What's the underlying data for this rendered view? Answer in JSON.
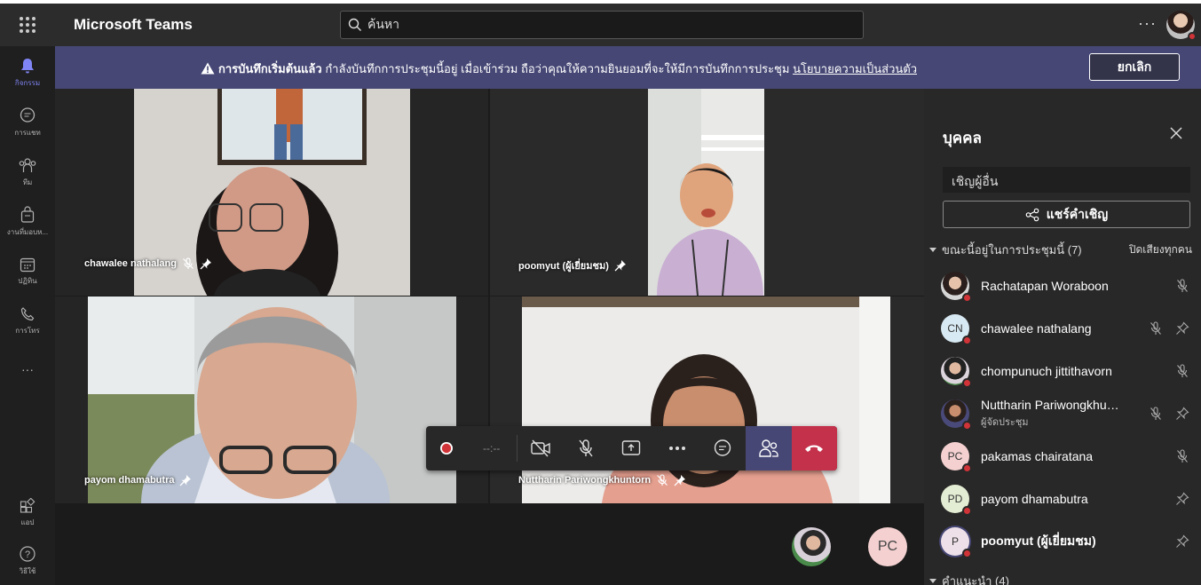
{
  "app": {
    "title": "Microsoft Teams",
    "search_placeholder": "ค้นหา",
    "more_label": "···"
  },
  "rail": [
    {
      "label": "กิจกรรม",
      "icon": "bell-icon",
      "active": true
    },
    {
      "label": "การแชท",
      "icon": "chat-icon"
    },
    {
      "label": "ทีม",
      "icon": "teams-icon"
    },
    {
      "label": "งานที่มอบห...",
      "icon": "assignments-icon"
    },
    {
      "label": "ปฏิทิน",
      "icon": "calendar-icon"
    },
    {
      "label": "การโทร",
      "icon": "phone-icon"
    },
    {
      "label": "···",
      "icon": "more-icon"
    },
    {
      "label": "แอป",
      "icon": "apps-icon"
    },
    {
      "label": "วิธีใช้",
      "icon": "help-icon"
    }
  ],
  "banner": {
    "title": "การบันทึกเริ่มต้นแล้ว",
    "message": " กำลังบันทึกการประชุมนี้อยู่ เมื่อเข้าร่วม ถือว่าคุณให้ความยินยอมที่จะให้มีการบันทึกการประชุม ",
    "link": "นโยบายความเป็นส่วนตัว",
    "cancel_label": "ยกเลิก"
  },
  "tiles": [
    {
      "name": "chawalee nathalang"
    },
    {
      "name": "poomyut (ผู้เยี่ยมชม)"
    },
    {
      "name": "payom dhamabutra"
    },
    {
      "name": "Nuttharin Pariwongkhuntorn"
    }
  ],
  "controls": {
    "timer": "--:--"
  },
  "overflow": {
    "initials": "PC"
  },
  "panel": {
    "title": "บุคคล",
    "invite_placeholder": "เชิญผู้อื่น",
    "share_label": "แชร์คำเชิญ",
    "in_meeting_label": "ขณะนี้อยู่ในการประชุมนี้ (7)",
    "mute_all_label": "ปิดเสียงทุกคน",
    "suggested_label": "คำแนะนำ (4)",
    "people": [
      {
        "name": "Rachatapan Woraboon",
        "initials": "",
        "role": ""
      },
      {
        "name": "chawalee nathalang",
        "initials": "CN",
        "role": ""
      },
      {
        "name": "chompunuch jittithavorn",
        "initials": "",
        "role": ""
      },
      {
        "name": "Nuttharin Pariwongkhuntorn",
        "initials": "",
        "role": "ผู้จัดประชุม"
      },
      {
        "name": "pakamas chairatana",
        "initials": "PC",
        "role": ""
      },
      {
        "name": "payom dhamabutra",
        "initials": "PD",
        "role": ""
      },
      {
        "name": "poomyut (ผู้เยี่ยมชม)",
        "initials": "P",
        "role": ""
      }
    ]
  }
}
